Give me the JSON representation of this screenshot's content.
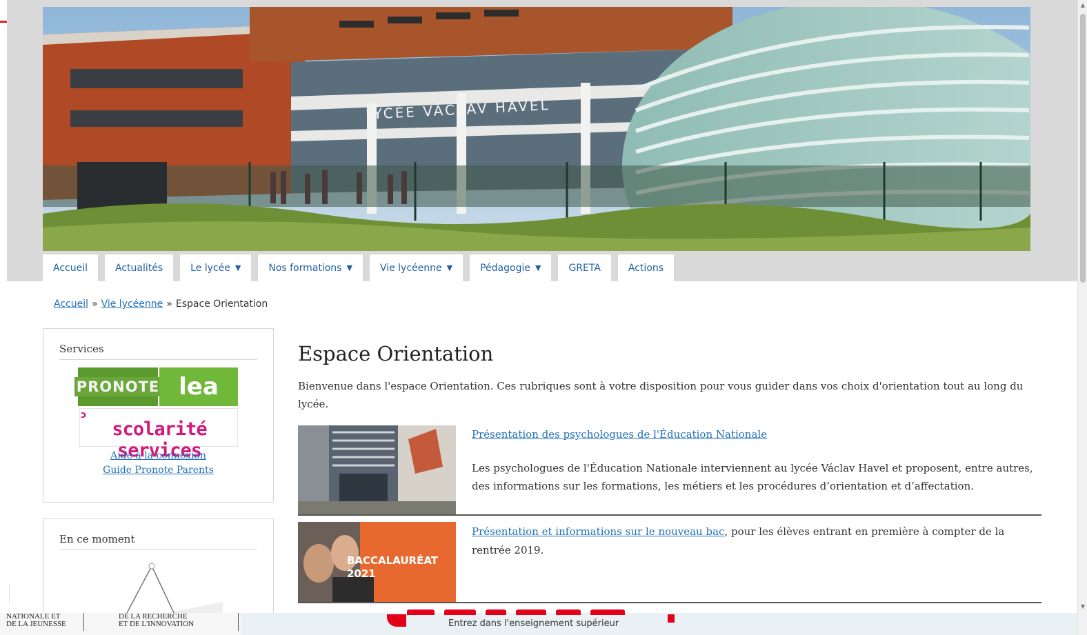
{
  "nav": {
    "items": [
      {
        "label": "Accueil",
        "dropdown": false
      },
      {
        "label": "Actualités",
        "dropdown": false
      },
      {
        "label": "Le lycée",
        "dropdown": true
      },
      {
        "label": "Nos formations",
        "dropdown": true
      },
      {
        "label": "Vie lycéenne",
        "dropdown": true
      },
      {
        "label": "Pédagogie",
        "dropdown": true
      },
      {
        "label": "GRETA",
        "dropdown": false
      },
      {
        "label": "Actions",
        "dropdown": false
      }
    ],
    "caret": "▼",
    "color": "#1f5fa7"
  },
  "hero": {
    "building_sign": "LYCÉE VÁCLAV HAVEL"
  },
  "breadcrumb": {
    "home": "Accueil",
    "section": "Vie lycéenne",
    "current": "Espace Orientation",
    "separator": "»"
  },
  "sidebar": {
    "services": {
      "title": "Services",
      "pronote_logo": "PRONOTE",
      "lea_logo": "lea",
      "scolarite_logo": "scolarité services",
      "links": [
        "Aide à la connexion",
        "Guide Pronote Parents"
      ]
    },
    "moment": {
      "title": "En ce moment"
    }
  },
  "main": {
    "title": "Espace Orientation",
    "intro": "Bienvenue dans l'espace Orientation. Ces rubriques sont à votre disposition pour vous guider dans vos choix d'orientation tout au long du lycée.",
    "articles": [
      {
        "link": "Présentation des psychologues de l'Éducation Nationale",
        "text": "Les psychologues de l'Éducation Nationale interviennent au lycée Václav Havel et proposent, entre autres, des informations sur les formations, les métiers et les procédures d’orientation et d’affectation."
      },
      {
        "link": "Présentation et informations sur le nouveau bac",
        "text": ", pour les élèves entrant en première à compter de la rentrée 2019.",
        "thumb_title": "BACCALAURÉAT",
        "thumb_year": "2021"
      }
    ]
  },
  "footer_banner": {
    "ministry_1": [
      "NATIONALE ET",
      "DE LA JEUNESSE"
    ],
    "ministry_2": [
      "DE LA RECHERCHE",
      "ET DE L'INNOVATION"
    ],
    "tagline": "Entrez dans l'enseignement supérieur"
  },
  "colors": {
    "link": "#1f6fb8",
    "accent_red": "#d62828",
    "pronote_green": "#5b9a2e",
    "scolarite_pink": "#d2197a",
    "bac_orange": "#e8692f"
  }
}
